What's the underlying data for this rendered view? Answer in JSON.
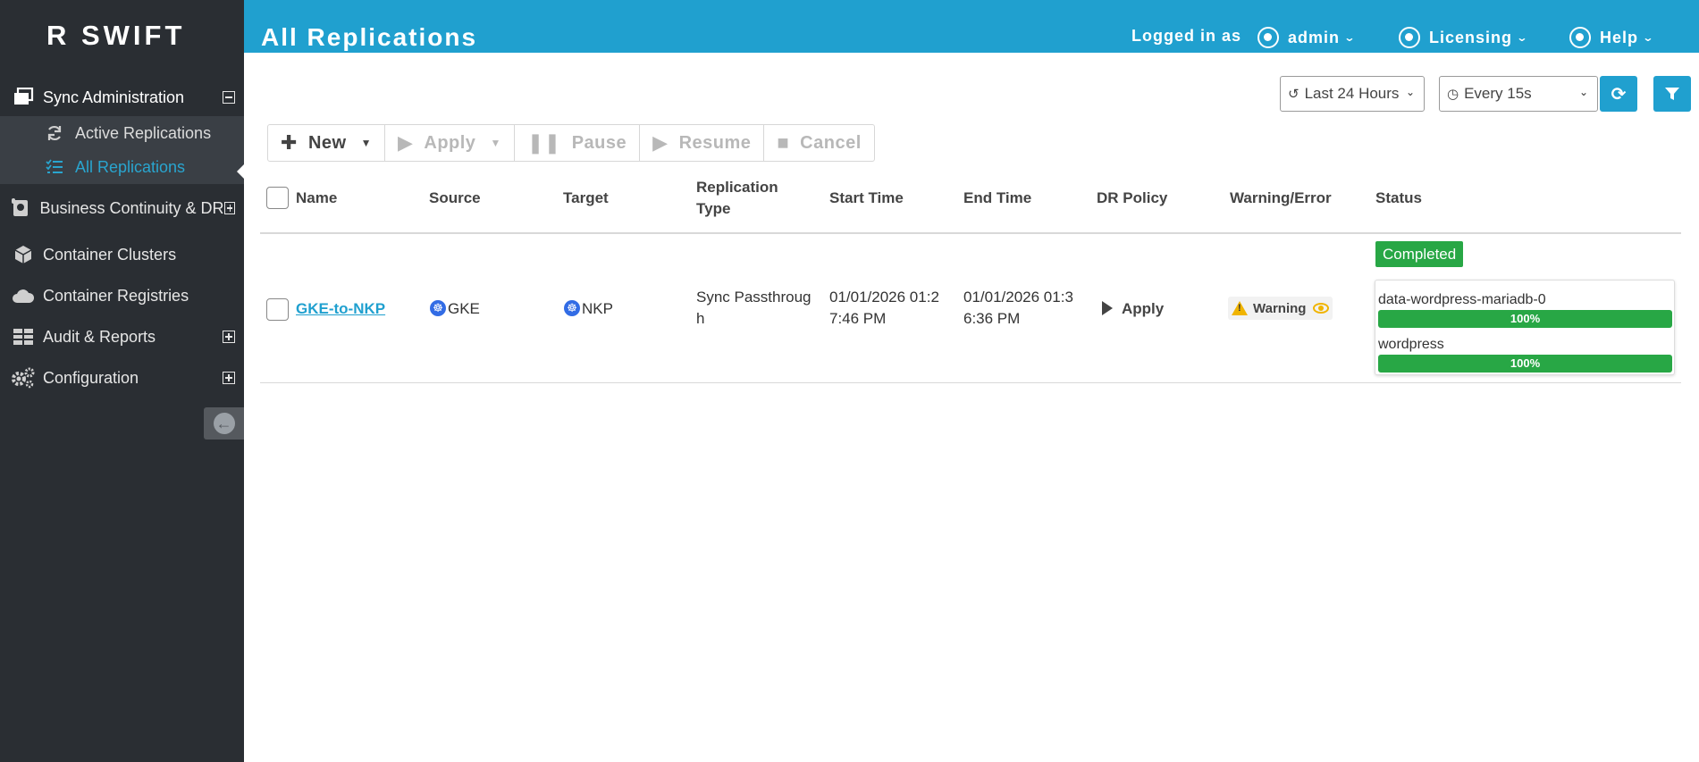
{
  "brand": {
    "logo_text": "R  SWIFT"
  },
  "sidebar": {
    "items": [
      {
        "label": "Sync Administration"
      },
      {
        "label": "Active Replications"
      },
      {
        "label": "All Replications"
      },
      {
        "label": "Business Continuity & DR"
      },
      {
        "label": "Container Clusters"
      },
      {
        "label": "Container Registries"
      },
      {
        "label": "Audit & Reports"
      },
      {
        "label": "Configuration"
      }
    ]
  },
  "header": {
    "title": "All Replications",
    "logged_in_label": "Logged in as",
    "user": "admin",
    "licensing": "Licensing",
    "help": "Help"
  },
  "controls": {
    "time_range": "Last 24 Hours",
    "refresh_interval": "Every 15s"
  },
  "toolbar": {
    "new": "New",
    "apply": "Apply",
    "pause": "Pause",
    "resume": "Resume",
    "cancel": "Cancel"
  },
  "table": {
    "columns": [
      "Name",
      "Source",
      "Target",
      "Replication",
      "Type",
      "Start Time",
      "End Time",
      "DR Policy",
      "Warning/Error",
      "Status"
    ],
    "rows": [
      {
        "name": "GKE-to-NKP",
        "source": "GKE",
        "target": "NKP",
        "type_line1": "Sync Passthroug",
        "type_line2": "h",
        "start_line1": "01/01/2026 01:2",
        "start_line2": "7:46 PM",
        "end_line1": "01/01/2026 01:3",
        "end_line2": "6:36 PM",
        "dr_policy": "Apply",
        "warning": "Warning",
        "status": "Completed",
        "volumes": [
          {
            "name": "data-wordpress-mariadb-0",
            "progress_label": "100%",
            "progress": 1.0
          },
          {
            "name": "wordpress",
            "progress_label": "100%",
            "progress": 1.0
          }
        ]
      }
    ]
  },
  "colors": {
    "accent": "#20a0cf",
    "sidebar_bg": "#2a2e33",
    "success": "#28a745",
    "warning": "#f0b400"
  }
}
